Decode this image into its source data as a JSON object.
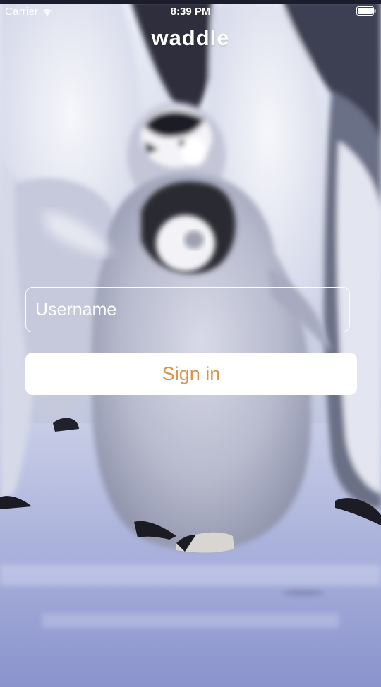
{
  "status_bar": {
    "carrier": "Carrier",
    "time": "8:39 PM",
    "wifi_icon": "wifi-icon",
    "battery_icon": "battery-icon"
  },
  "app": {
    "title": "waddle"
  },
  "form": {
    "username_placeholder": "Username",
    "username_value": "",
    "signin_label": "Sign in"
  },
  "colors": {
    "signin_text": "#d9934a",
    "field_border": "#ffffff",
    "background_tint": "#c9cfe3"
  }
}
